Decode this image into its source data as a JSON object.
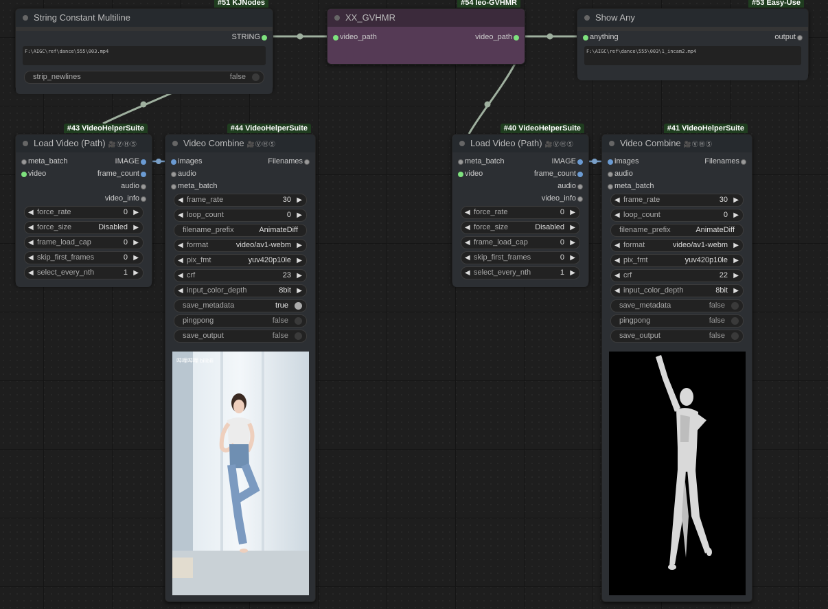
{
  "nodes": {
    "string_const": {
      "tag": "#51 KJNodes",
      "title": "String Constant Multiline",
      "output": "STRING",
      "text": "F:\\AIGC\\ref\\dance\\555\\003.mp4",
      "widget_label": "strip_newlines",
      "widget_value": "false"
    },
    "gvhmr": {
      "tag": "#54 leo-GVHMR",
      "title": "XX_GVHMR",
      "input": "video_path",
      "output": "video_path"
    },
    "show_any": {
      "tag": "#53 Easy-Use",
      "title": "Show Any",
      "input": "anything",
      "output": "output",
      "text": "F:\\AIGC\\ref\\dance\\555\\003\\1_incam2.mp4"
    },
    "load43": {
      "tag": "#43 VideoHelperSuite",
      "title": "Load Video (Path)",
      "badge": "🎥ⓋⒽⓈ",
      "inputs": [
        "meta_batch",
        "video"
      ],
      "outputs": [
        "IMAGE",
        "frame_count",
        "audio",
        "video_info"
      ],
      "widgets": [
        {
          "label": "force_rate",
          "value": "0"
        },
        {
          "label": "force_size",
          "value": "Disabled"
        },
        {
          "label": "frame_load_cap",
          "value": "0"
        },
        {
          "label": "skip_first_frames",
          "value": "0"
        },
        {
          "label": "select_every_nth",
          "value": "1"
        }
      ]
    },
    "combine44": {
      "tag": "#44 VideoHelperSuite",
      "title": "Video Combine",
      "badge": "🎥ⓋⒽⓈ",
      "inputs": [
        "images",
        "audio",
        "meta_batch"
      ],
      "output": "Filenames",
      "widgets": [
        {
          "label": "frame_rate",
          "value": "30"
        },
        {
          "label": "loop_count",
          "value": "0"
        },
        {
          "label": "filename_prefix",
          "value": "AnimateDiff"
        },
        {
          "label": "format",
          "value": "video/av1-webm"
        },
        {
          "label": "pix_fmt",
          "value": "yuv420p10le"
        },
        {
          "label": "crf",
          "value": "23"
        },
        {
          "label": "input_color_depth",
          "value": "8bit"
        },
        {
          "label": "save_metadata",
          "value": "true"
        },
        {
          "label": "pingpong",
          "value": "false"
        },
        {
          "label": "save_output",
          "value": "false"
        }
      ],
      "watermark": "哔哩哔哩 bilibili"
    },
    "load40": {
      "tag": "#40 VideoHelperSuite",
      "title": "Load Video (Path)",
      "badge": "🎥ⓋⒽⓈ",
      "inputs": [
        "meta_batch",
        "video"
      ],
      "outputs": [
        "IMAGE",
        "frame_count",
        "audio",
        "video_info"
      ],
      "widgets": [
        {
          "label": "force_rate",
          "value": "0"
        },
        {
          "label": "force_size",
          "value": "Disabled"
        },
        {
          "label": "frame_load_cap",
          "value": "0"
        },
        {
          "label": "skip_first_frames",
          "value": "0"
        },
        {
          "label": "select_every_nth",
          "value": "1"
        }
      ]
    },
    "combine41": {
      "tag": "#41 VideoHelperSuite",
      "title": "Video Combine",
      "badge": "🎥ⓋⒽⓈ",
      "inputs": [
        "images",
        "audio",
        "meta_batch"
      ],
      "output": "Filenames",
      "widgets": [
        {
          "label": "frame_rate",
          "value": "30"
        },
        {
          "label": "loop_count",
          "value": "0"
        },
        {
          "label": "filename_prefix",
          "value": "AnimateDiff"
        },
        {
          "label": "format",
          "value": "video/av1-webm"
        },
        {
          "label": "pix_fmt",
          "value": "yuv420p10le"
        },
        {
          "label": "crf",
          "value": "22"
        },
        {
          "label": "input_color_depth",
          "value": "8bit"
        },
        {
          "label": "save_metadata",
          "value": "false"
        },
        {
          "label": "pingpong",
          "value": "false"
        },
        {
          "label": "save_output",
          "value": "false"
        }
      ]
    }
  },
  "colors": {
    "link": "#9fb09f",
    "gvhmr_body": "#553a55",
    "tag_bg": "#1f3d1f"
  }
}
